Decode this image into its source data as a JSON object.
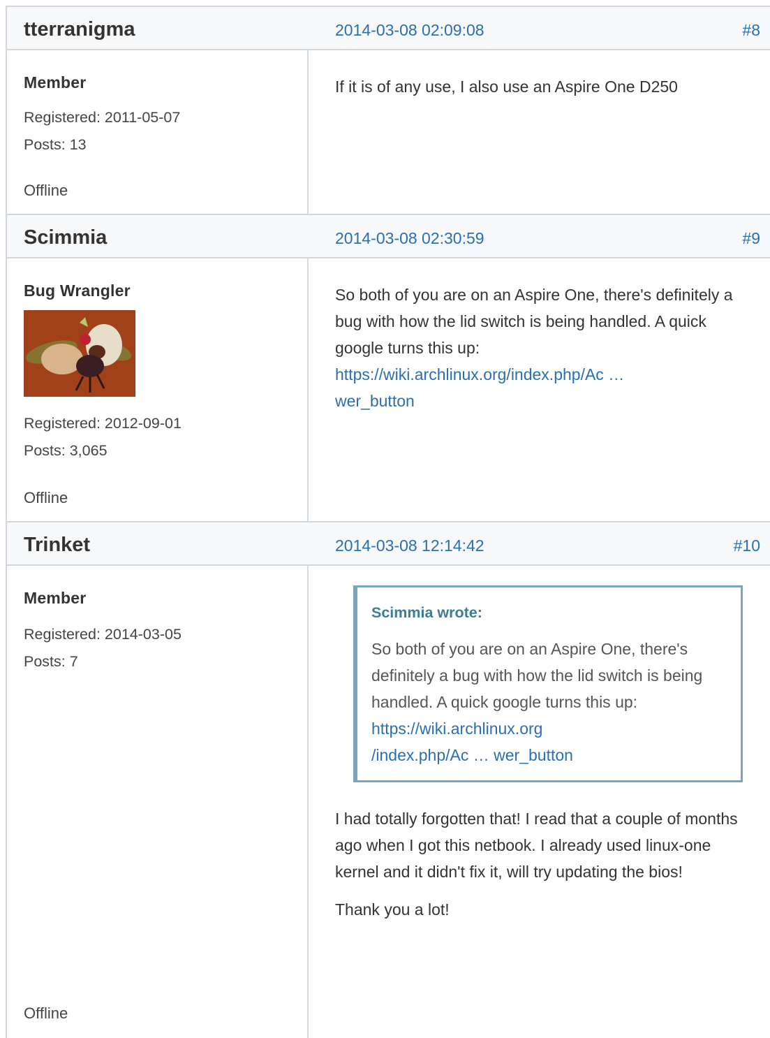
{
  "posts": [
    {
      "author": "tterranigma",
      "date": "2014-03-08 02:09:08",
      "number": "#8",
      "rank": "Member",
      "registered": "Registered: 2011-05-07",
      "posts_count": "Posts: 13",
      "status": "Offline",
      "paragraphs": [
        "If it is of any use, I also use an Aspire One D250"
      ]
    },
    {
      "author": "Scimmia",
      "date": "2014-03-08 02:30:59",
      "number": "#9",
      "rank": "Bug Wrangler",
      "registered": "Registered: 2012-09-01",
      "posts_count": "Posts: 3,065",
      "status": "Offline",
      "text": "So both of you are on an Aspire One, there's definitely a bug with how the lid switch is being handled. A quick google turns this up:",
      "link_part1": "https://wiki.archlinux.org/index.php/Ac …",
      "link_part2": "wer_button"
    },
    {
      "author": "Trinket",
      "date": "2014-03-08 12:14:42",
      "number": "#10",
      "rank": "Member",
      "registered": "Registered: 2014-03-05",
      "posts_count": "Posts: 7",
      "status": "Offline",
      "quote": {
        "author": "Scimmia wrote:",
        "text": "So both of you are on an Aspire One, there's definitely a bug with how the lid switch is being handled. A quick google turns this up:",
        "link_part1": "https://wiki.archlinux.org",
        "link_part2": "/index.php/Ac … wer_button"
      },
      "paragraphs": [
        "I had totally forgotten that! I read that a couple of months ago when I got this netbook. I already used linux-one kernel and it didn't fix it, will try updating the bios!",
        "Thank you a lot!"
      ]
    }
  ]
}
